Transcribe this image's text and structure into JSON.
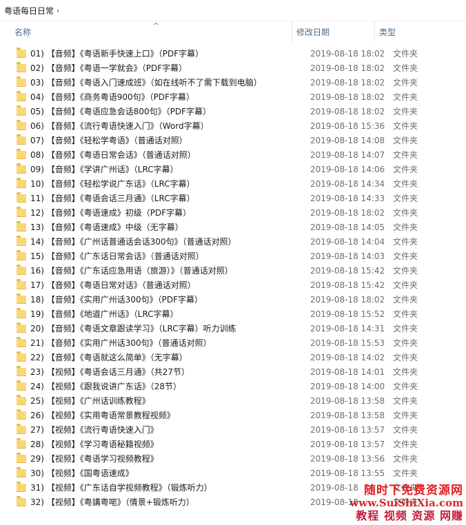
{
  "breadcrumb": {
    "label": "粤语每日日常",
    "separator": "›"
  },
  "header": {
    "sort_arrow": "^",
    "name": "名称",
    "date": "修改日期",
    "type": "类型"
  },
  "colors": {
    "folder": "#f8d775",
    "header_text": "#4d6a8a",
    "watermark_red": "#e02020"
  },
  "icons": {
    "folder": "folder-icon"
  },
  "rows": [
    {
      "name": "01) 【音频】《粤语新手快速上口》（PDF字幕）",
      "date": "2019-08-18 18:02",
      "type": "文件夹"
    },
    {
      "name": "02) 【音频】《粤语一学就会》（PDF字幕）",
      "date": "2019-08-18 18:02",
      "type": "文件夹"
    },
    {
      "name": "03) 【音频】《粤语入门速成班》（如在线听不了需下载到电脑）",
      "date": "2019-08-18 18:02",
      "type": "文件夹"
    },
    {
      "name": "04) 【音频】《商务粤语900句》（PDF字幕）",
      "date": "2019-08-18 18:02",
      "type": "文件夹"
    },
    {
      "name": "05) 【音频】《粤语应急会话800句》（PDF字幕）",
      "date": "2019-08-18 18:02",
      "type": "文件夹"
    },
    {
      "name": "06) 【音频】《流行粤语快速入门》（Word字幕）",
      "date": "2019-08-18 15:36",
      "type": "文件夹"
    },
    {
      "name": "07) 【音频】《轻松学粤语》（普通话对照）",
      "date": "2019-08-18 14:08",
      "type": "文件夹"
    },
    {
      "name": "08) 【音频】《粤语日常会话》（普通话对照）",
      "date": "2019-08-18 14:07",
      "type": "文件夹"
    },
    {
      "name": "09) 【音频】《学讲广州话》（LRC字幕）",
      "date": "2019-08-18 14:06",
      "type": "文件夹"
    },
    {
      "name": "10) 【音频】《轻松学说广东话》（LRC字幕）",
      "date": "2019-08-18 14:34",
      "type": "文件夹"
    },
    {
      "name": "11) 【音频】《粤语会话三月通》（LRC字幕）",
      "date": "2019-08-18 14:33",
      "type": "文件夹"
    },
    {
      "name": "12) 【音频】《粤语速成》初级（PDF字幕）",
      "date": "2019-08-18 18:02",
      "type": "文件夹"
    },
    {
      "name": "13) 【音频】《粤语速成》中级（无字幕）",
      "date": "2019-08-18 14:05",
      "type": "文件夹"
    },
    {
      "name": "14) 【音频】《广州话普通话会话300句》（普通话对照）",
      "date": "2019-08-18 14:04",
      "type": "文件夹"
    },
    {
      "name": "15) 【音频】《广东话日常会话》（普通话对照）",
      "date": "2019-08-18 14:03",
      "type": "文件夹"
    },
    {
      "name": "16) 【音频】《广东话应急用语（旅游）》（普通话对照）",
      "date": "2019-08-18 15:42",
      "type": "文件夹"
    },
    {
      "name": "17) 【音频】《粤语日常对话》（普通话对照）",
      "date": "2019-08-18 15:42",
      "type": "文件夹"
    },
    {
      "name": "18) 【音频】《实用广州话300句》（PDF字幕）",
      "date": "2019-08-18 18:02",
      "type": "文件夹"
    },
    {
      "name": "19) 【音频】《地道广州话》（LRC字幕）",
      "date": "2019-08-18 15:52",
      "type": "文件夹"
    },
    {
      "name": "20) 【音频】《粤语文章跟读学习》（LRC字幕）听力训练",
      "date": "2019-08-18 14:31",
      "type": "文件夹"
    },
    {
      "name": "21) 【音频】《实用广州话300句》（普通话对照）",
      "date": "2019-08-18 15:53",
      "type": "文件夹"
    },
    {
      "name": "22) 【音频】《粤语就这么简单》（无字幕）",
      "date": "2019-08-18 14:02",
      "type": "文件夹"
    },
    {
      "name": "23) 【视频】《粤语会话三月通》（共27节）",
      "date": "2019-08-18 14:01",
      "type": "文件夹"
    },
    {
      "name": "24) 【视频】《跟我说讲广东话》（28节）",
      "date": "2019-08-18 14:00",
      "type": "文件夹"
    },
    {
      "name": "25) 【视频】《广州话训练教程》",
      "date": "2019-08-18 13:58",
      "type": "文件夹"
    },
    {
      "name": "26) 【视频】《实用粤语常景教程视频》",
      "date": "2019-08-18 13:58",
      "type": "文件夹"
    },
    {
      "name": "27) 【视频】《流行粤语快速入门》",
      "date": "2019-08-18 13:57",
      "type": "文件夹"
    },
    {
      "name": "28) 【视频】《学习粤语秘籍视频》",
      "date": "2019-08-18 13:57",
      "type": "文件夹"
    },
    {
      "name": "29) 【视频】《粤语学习视频教程》",
      "date": "2019-08-18 13:56",
      "type": "文件夹"
    },
    {
      "name": "30) 【视频】《国粤语速成》",
      "date": "2019-08-18 13:55",
      "type": "文件夹"
    },
    {
      "name": "31) 【视频】《广东话自学视频教程》（锻炼听力）",
      "date": "2019-08-18",
      "type": "文件夹"
    },
    {
      "name": "32) 【视频】《粤講粤啱》（情景+锻炼听力）",
      "date": "2019-08-18",
      "type": "文件夹"
    }
  ],
  "watermark": {
    "line1": "随时下免费资源网",
    "line2": "www.SuiShiXia.com",
    "line3": "教程 视频 资源 网赚"
  }
}
